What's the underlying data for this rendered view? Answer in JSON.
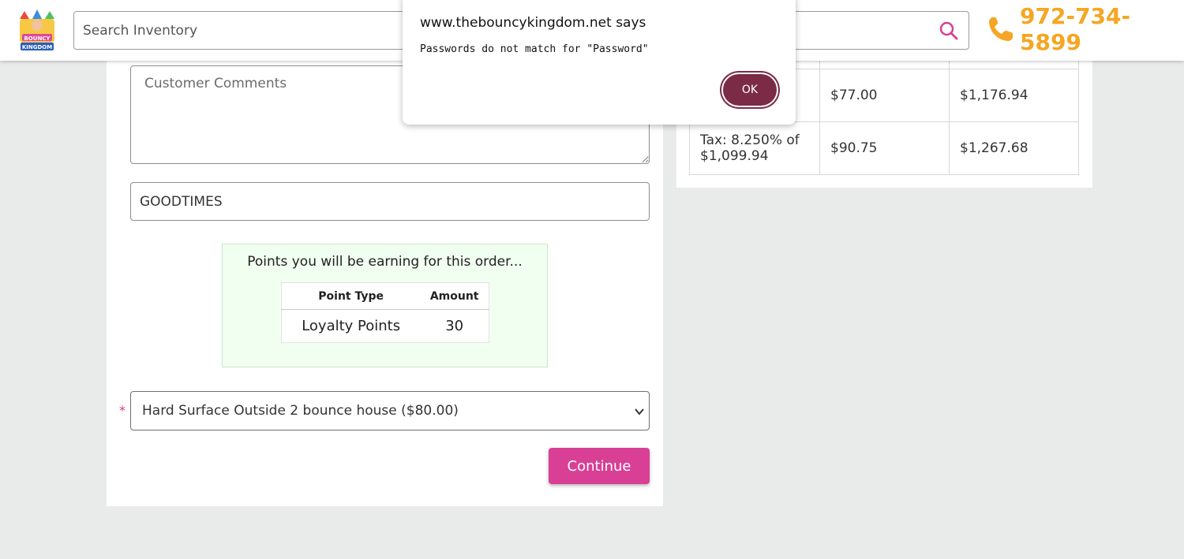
{
  "header": {
    "search_placeholder": "Search Inventory",
    "phone": "972-734-5899"
  },
  "form": {
    "comments_placeholder": "Customer Comments",
    "coupon_value": "GOODTIMES",
    "points": {
      "title": "Points you will be earning for this order...",
      "columns": [
        "Point Type",
        "Amount"
      ],
      "rows": [
        {
          "type": "Loyalty Points",
          "amount": "30"
        }
      ]
    },
    "required_mark": "*",
    "surface_selected": "Hard Surface Outside 2 bounce house ($80.00)",
    "continue_label": "Continue"
  },
  "totals": {
    "rows": [
      {
        "label": "",
        "amount": "$77.00",
        "total": "$1,176.94"
      },
      {
        "label": "Tax: 8.250% of $1,099.94",
        "amount": "$90.75",
        "total": "$1,267.68"
      }
    ]
  },
  "alert": {
    "origin": "www.thebouncykingdom.net says",
    "message": "Passwords do not match for \"Password\"",
    "ok_label": "OK"
  },
  "colors": {
    "accent_pink": "#d93f95",
    "phone_orange": "#f5a623",
    "dialog_button": "#7b2b45",
    "points_bg": "#f1fff1"
  },
  "icons": [
    "logo-icon",
    "search-icon",
    "phone-icon",
    "chevron-down-icon"
  ]
}
